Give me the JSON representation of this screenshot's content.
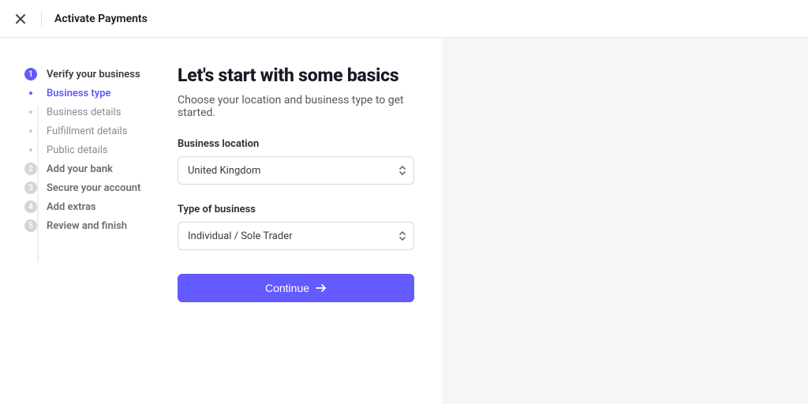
{
  "header": {
    "title": "Activate Payments"
  },
  "sidebar": {
    "steps": [
      {
        "num": "1",
        "label": "Verify your business",
        "substeps": [
          {
            "label": "Business type"
          },
          {
            "label": "Business details"
          },
          {
            "label": "Fulfillment details"
          },
          {
            "label": "Public details"
          }
        ]
      },
      {
        "num": "2",
        "label": "Add your bank"
      },
      {
        "num": "3",
        "label": "Secure your account"
      },
      {
        "num": "4",
        "label": "Add extras"
      },
      {
        "num": "5",
        "label": "Review and finish"
      }
    ]
  },
  "main": {
    "heading": "Let's start with some basics",
    "subtitle": "Choose your location and business type to get started.",
    "location_label": "Business location",
    "location_value": "United Kingdom",
    "type_label": "Type of business",
    "type_value": "Individual / Sole Trader",
    "continue_label": "Continue"
  }
}
